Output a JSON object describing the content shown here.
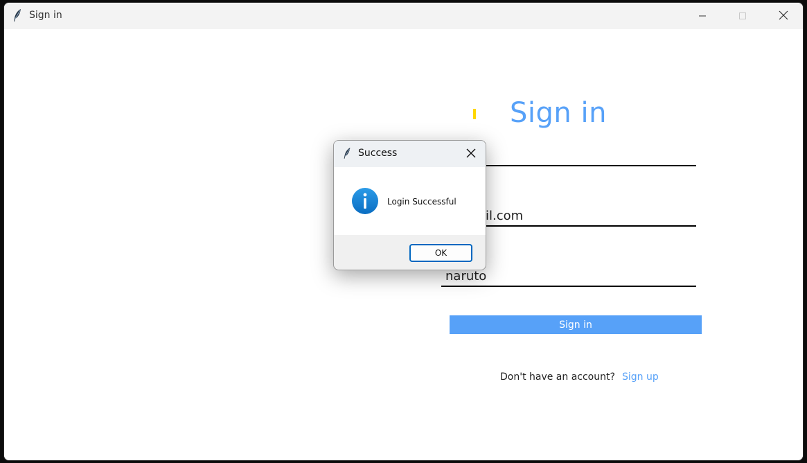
{
  "window": {
    "title": "Sign in",
    "icon": "feather-icon",
    "controls": [
      "minimize-icon",
      "maximize-icon",
      "close-icon"
    ]
  },
  "form": {
    "heading": "Sign in",
    "username_value": "",
    "email_value": "@gmail.com",
    "password_value": "naruto",
    "signin_label": "Sign in",
    "footer_text": "Don't have an account?",
    "signup_label": "Sign up"
  },
  "dialog": {
    "title": "Success",
    "icon": "feather-icon",
    "message_icon": "info-icon",
    "message": "Login Successful",
    "ok_label": "OK"
  },
  "colors": {
    "accent": "#57a1f8",
    "marker": "#ffd700",
    "dialog_button_border": "#0067c0"
  }
}
